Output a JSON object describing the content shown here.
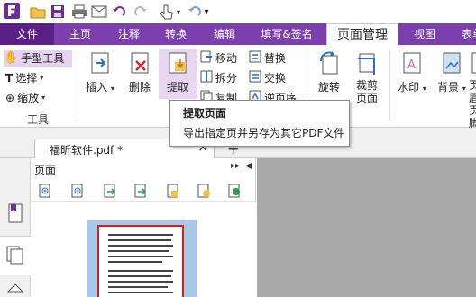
{
  "menu_tabs": [
    "文件",
    "主页",
    "注释",
    "转换",
    "编辑",
    "填写&签名",
    "页面管理",
    "视图",
    "表单"
  ],
  "ribbon": {
    "tools": {
      "hand": "手型工具",
      "select": "选择",
      "zoom": "缩放",
      "group": "工具"
    },
    "insert": "插入",
    "delete": "删除",
    "extract": "提取",
    "move": "移动",
    "split": "拆分",
    "copy": "复制",
    "replace": "替换",
    "swap": "交换",
    "reverse": "逆页序",
    "rotate": "旋转",
    "crop": "裁剪页面",
    "watermark": "水印",
    "background": "背景",
    "header_footer": "页眉页脚"
  },
  "tooltip": {
    "title": "提取页面",
    "description": "导出指定页并另存为其它PDF文件"
  },
  "document_tab": {
    "name": "福昕软件.pdf *",
    "close": "×",
    "new": "+"
  },
  "panel": {
    "title": "页面",
    "expand": "▸▸",
    "collapse": "◀"
  },
  "colors": {
    "accent": "#7b3fae",
    "tab_dark": "#5b2088",
    "selection": "#d21f1f",
    "thumb_bg": "#a8c8e8",
    "doc_bg": "#a9a9a9"
  }
}
